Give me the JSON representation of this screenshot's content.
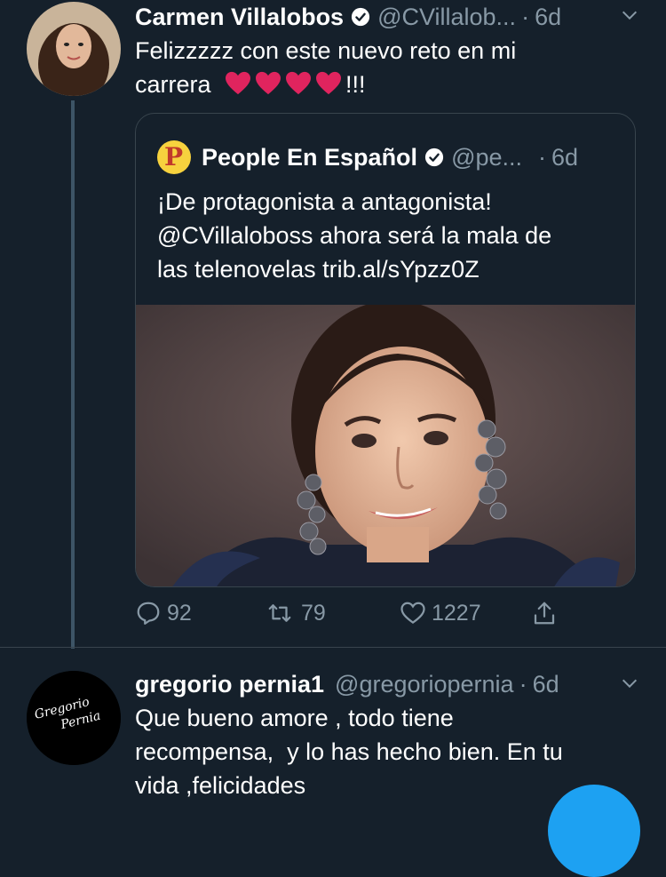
{
  "tweet1": {
    "name": "Carmen Villalobos",
    "handle": "@CVillalob...",
    "sep": "·",
    "time": "6d",
    "text_line1": "Felizzzzz con este nuevo reto en mi",
    "text_line2_prefix": "carrera",
    "text_line2_suffix": "!!!",
    "hearts": 4,
    "heart_color": "#e0245e"
  },
  "quote": {
    "name": "People En Español",
    "handle": "@pe...",
    "sep": "·",
    "time": "6d",
    "logo_letter": "P",
    "line1": "¡De protagonista a antagonista!",
    "line2": "@CVillaloboss ahora será la mala de",
    "line3": "las telenovelas trib.al/sYpzz0Z"
  },
  "actions": {
    "replies": "92",
    "retweets": "79",
    "likes": "1227"
  },
  "tweet2": {
    "name": "gregorio pernia1",
    "handle": "@gregoriopernia",
    "sep": "·",
    "time": "6d",
    "line1": "Que bueno amore , todo tiene",
    "line2": "recompensa,  y lo has hecho bien. En tu",
    "line3": "vida ,felicidades",
    "avatar_text1": "Gregorio",
    "avatar_text2": "Pernia"
  },
  "colors": {
    "background": "#15202b",
    "muted": "#8899a6",
    "border": "#38444d",
    "accent": "#1da1f2",
    "verified": "#ffffff"
  }
}
